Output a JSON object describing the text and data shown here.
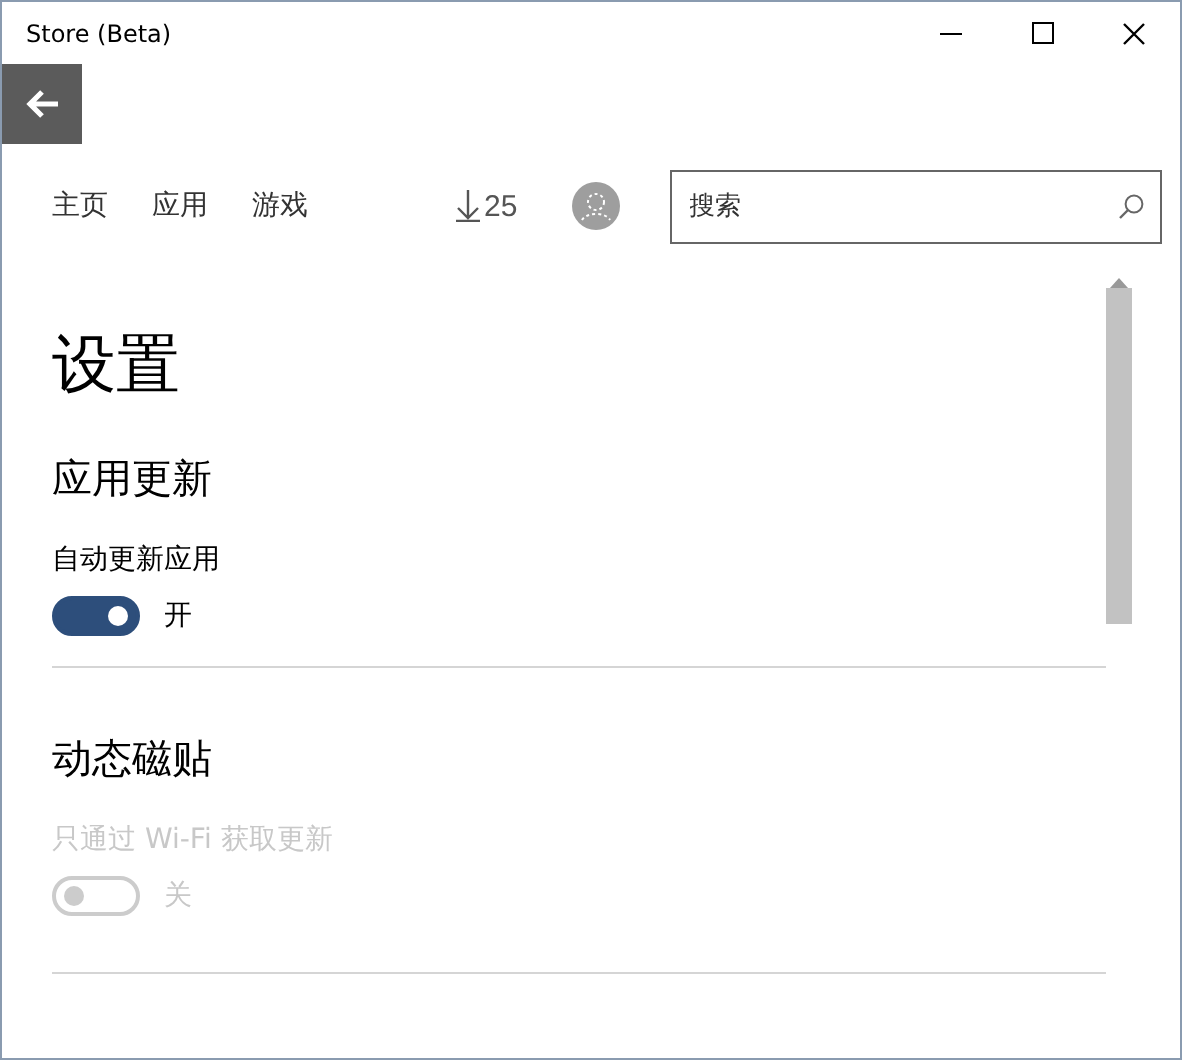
{
  "window": {
    "title": "Store (Beta)"
  },
  "nav": {
    "items": [
      "主页",
      "应用",
      "游戏"
    ],
    "downloads": "25",
    "search": {
      "placeholder": "搜索"
    }
  },
  "page_title": "设置",
  "sections": [
    {
      "heading": "应用更新",
      "settings": [
        {
          "label": "自动更新应用",
          "on": true,
          "disabled": false,
          "state_text": "开"
        }
      ]
    },
    {
      "heading": "动态磁贴",
      "settings": [
        {
          "label": "只通过 Wi-Fi 获取更新",
          "on": false,
          "disabled": true,
          "state_text": "关"
        }
      ]
    }
  ]
}
